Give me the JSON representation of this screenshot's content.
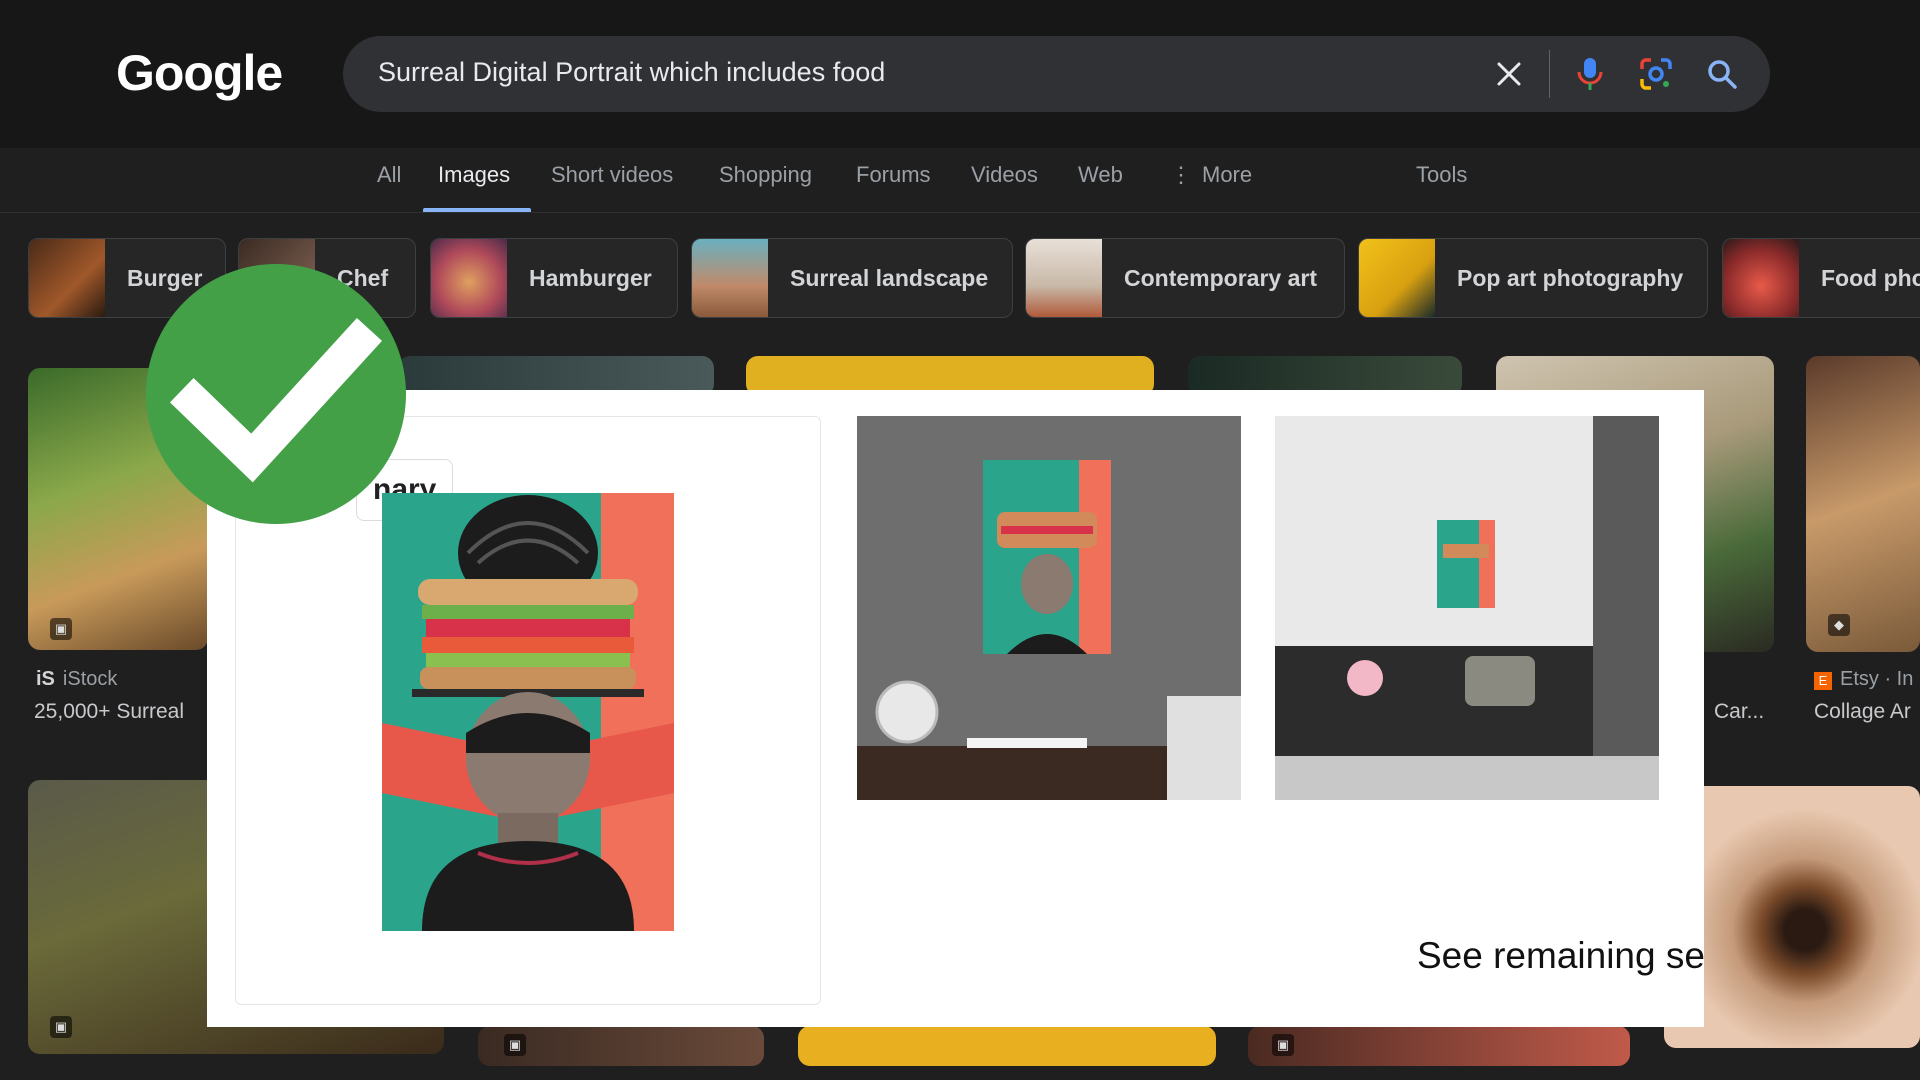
{
  "header": {
    "logo": "Google",
    "search_query": "Surreal Digital Portrait which includes food",
    "icons": [
      "clear-icon",
      "mic-icon",
      "lens-icon",
      "search-icon"
    ]
  },
  "tabs": [
    {
      "label": "All",
      "active": false
    },
    {
      "label": "Images",
      "active": true
    },
    {
      "label": "Short videos",
      "active": false
    },
    {
      "label": "Shopping",
      "active": false
    },
    {
      "label": "Forums",
      "active": false
    },
    {
      "label": "Videos",
      "active": false
    },
    {
      "label": "Web",
      "active": false
    },
    {
      "label": "More",
      "active": false
    },
    {
      "label": "Tools",
      "active": false
    }
  ],
  "chips": [
    {
      "label": "Burger"
    },
    {
      "label": "Chef"
    },
    {
      "label": "Hamburger"
    },
    {
      "label": "Surreal landscape"
    },
    {
      "label": "Contemporary art"
    },
    {
      "label": "Pop art photography"
    },
    {
      "label": "Food pho"
    }
  ],
  "results": {
    "left_source": "iStock",
    "left_caption": "25,000+ Surreal",
    "right_caption_partial": "Car...",
    "right_source": "Etsy · In",
    "right_caption": "Collage Ar"
  },
  "modal": {
    "card_label": "nary",
    "see_remaining": "See remaining se"
  },
  "overlay": {
    "icon": "checkmark-icon",
    "color": "#43a047"
  }
}
